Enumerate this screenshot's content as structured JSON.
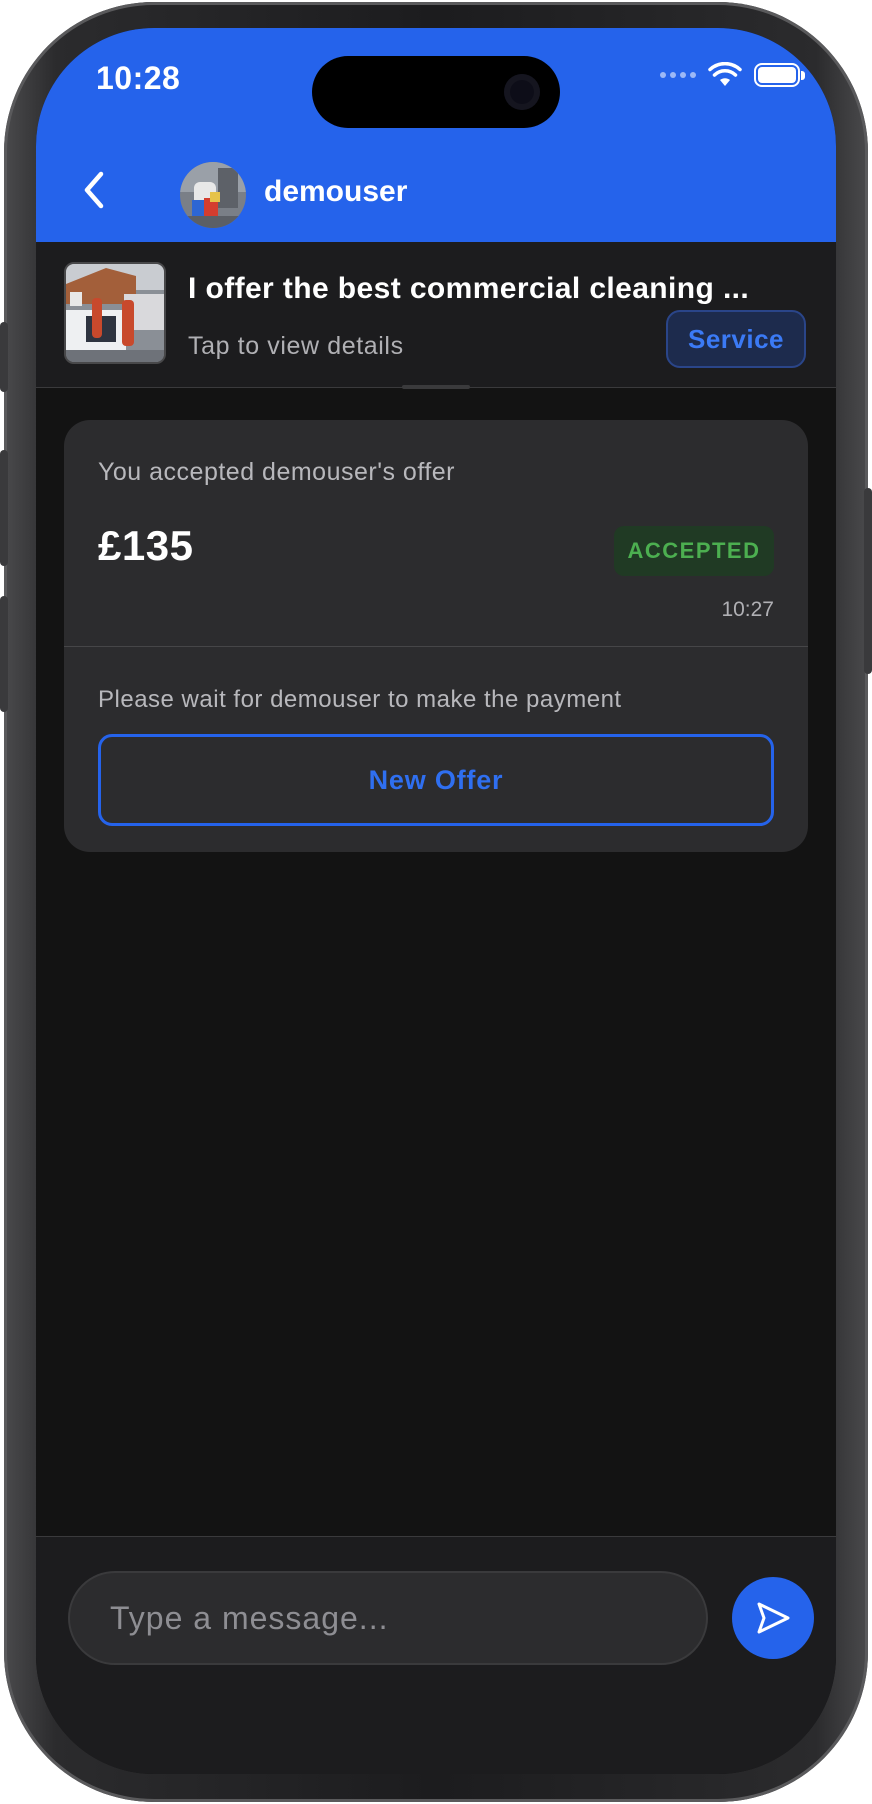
{
  "status_bar": {
    "time": "10:28"
  },
  "header": {
    "back_icon": "chevron-left-icon",
    "username": "demouser"
  },
  "listing": {
    "title": "I offer the best commercial cleaning ...",
    "subtitle": "Tap to view details",
    "badge": "Service"
  },
  "offer": {
    "label": "You accepted demouser's offer",
    "amount": "£135",
    "status": "ACCEPTED",
    "time": "10:27",
    "wait_text": "Please wait for demouser to make the payment",
    "new_offer_label": "New Offer"
  },
  "composer": {
    "placeholder": "Type a message...",
    "send_icon": "send-icon"
  },
  "colors": {
    "accent": "#2563eb",
    "success": "#4caf50",
    "background": "#131313",
    "card": "#2c2c2e"
  }
}
